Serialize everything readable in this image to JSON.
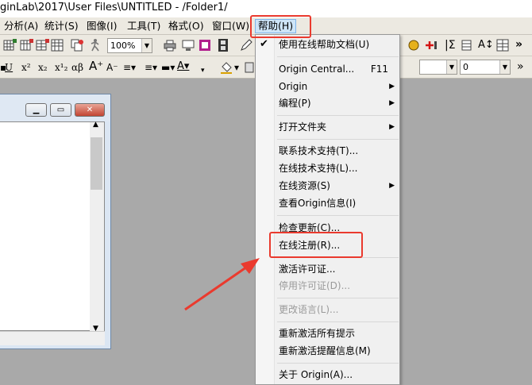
{
  "window": {
    "title": "ginLab\\2017\\User Files\\UNTITLED - /Folder1/"
  },
  "menubar": {
    "items": [
      {
        "label": "分析(A)"
      },
      {
        "label": "统计(S)"
      },
      {
        "label": "图像(I)"
      },
      {
        "label": "工具(T)"
      },
      {
        "label": "格式(O)"
      },
      {
        "label": "窗口(W)"
      },
      {
        "label": "帮助(H)"
      }
    ]
  },
  "toolbar1": {
    "zoom_value": "100%"
  },
  "toolbar2": {
    "font_size_value": "0"
  },
  "help_menu": {
    "items": [
      {
        "label": "使用在线帮助文档(U)",
        "checked": true
      },
      {
        "label": "Origin Central...",
        "shortcut": "F11"
      },
      {
        "label": "Origin",
        "submenu": true
      },
      {
        "label": "编程(P)",
        "submenu": true
      },
      {
        "label": "打开文件夹",
        "submenu": true
      },
      {
        "label": "联系技术支持(T)..."
      },
      {
        "label": "在线技术支持(L)..."
      },
      {
        "label": "在线资源(S)",
        "submenu": true
      },
      {
        "label": "查看Origin信息(I)"
      },
      {
        "label": "检查更新(C)..."
      },
      {
        "label": "在线注册(R)..."
      },
      {
        "label": "激活许可证..."
      },
      {
        "label": "停用许可证(D)...",
        "disabled": true
      },
      {
        "label": "更改语言(L)...",
        "disabled": true
      },
      {
        "label": "重新激活所有提示"
      },
      {
        "label": "重新激活提醒信息(M)"
      },
      {
        "label": "关于 Origin(A)..."
      }
    ]
  },
  "colors": {
    "highlight_annotation": "#ea3a2e",
    "active_menu_bg": "#cde4f7"
  }
}
